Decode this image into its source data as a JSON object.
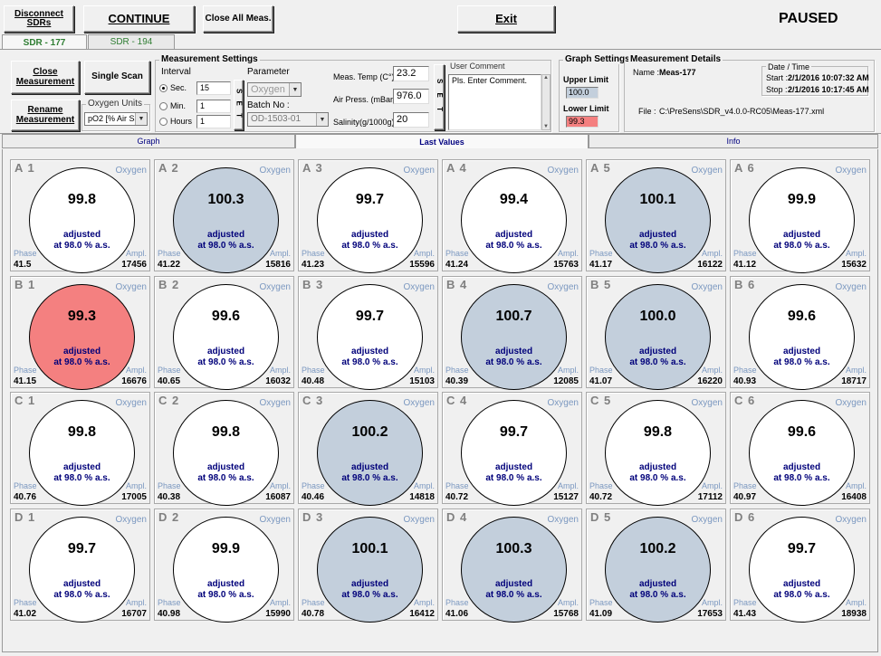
{
  "toolbar": {
    "disconnect_label": "Disconnect SDRs",
    "continue_label": "CONTINUE",
    "close_all_label": "Close All Meas.",
    "exit_label": "Exit",
    "status": "PAUSED"
  },
  "sdr_tabs": [
    {
      "label": "SDR - 177",
      "active": true
    },
    {
      "label": "SDR - 194",
      "active": false
    }
  ],
  "buttons": {
    "close_measurement": "Close Measurement",
    "single_scan": "Single Scan",
    "rename_measurement": "Rename Measurement"
  },
  "oxygen_units": {
    "legend": "Oxygen Units",
    "value": "pO2 [% Air Sat.]"
  },
  "measurement_settings": {
    "legend": "Measurement Settings",
    "interval_label": "Interval",
    "rows": [
      {
        "label": "Sec.",
        "value": "15",
        "selected": true
      },
      {
        "label": "Min.",
        "value": "1",
        "selected": false
      },
      {
        "label": "Hours",
        "value": "1",
        "selected": false
      }
    ],
    "set_label": "S E T",
    "parameter_label": "Parameter",
    "parameter_value": "Oxygen",
    "batch_label": "Batch No :",
    "batch_value": "OD-1503-01",
    "meas_temp_label": "Meas. Temp (C°):",
    "meas_temp_value": "23.2",
    "air_press_label": "Air Press. (mBar):",
    "air_press_value": "976.0",
    "salinity_label": "Salinity(g/1000g):",
    "salinity_value": "20",
    "set2_label": "S E T"
  },
  "user_comment": {
    "legend": "User Comment",
    "value": "Pls. Enter Comment."
  },
  "graph_settings": {
    "legend": "Graph Settings",
    "upper_label": "Upper Limit",
    "upper_value": "100.0",
    "lower_label": "Lower Limit",
    "lower_value": "99.3"
  },
  "details": {
    "legend": "Measurement Details",
    "name_label": "Name :",
    "name_value": "Meas-177",
    "date_legend": "Date / Time",
    "start_label": "Start :",
    "start_value": "2/1/2016 10:07:32 AM",
    "stop_label": "Stop :",
    "stop_value": "2/1/2016 10:17:45 AM",
    "file_label": "File :",
    "file_value": "C:\\PreSens\\SDR_v4.0.0-RC05\\Meas-177.xml"
  },
  "view_tabs": [
    {
      "label": "Graph",
      "active": false
    },
    {
      "label": "Last Values",
      "active": true
    },
    {
      "label": "Info",
      "active": false
    }
  ],
  "wells": [
    {
      "pos": "A 1",
      "value": "99.8",
      "phase": "41.5",
      "ampl": "17456",
      "state": "normal"
    },
    {
      "pos": "A 2",
      "value": "100.3",
      "phase": "41.22",
      "ampl": "15816",
      "state": "high"
    },
    {
      "pos": "A 3",
      "value": "99.7",
      "phase": "41.23",
      "ampl": "15596",
      "state": "normal"
    },
    {
      "pos": "A 4",
      "value": "99.4",
      "phase": "41.24",
      "ampl": "15763",
      "state": "normal"
    },
    {
      "pos": "A 5",
      "value": "100.1",
      "phase": "41.17",
      "ampl": "16122",
      "state": "high"
    },
    {
      "pos": "A 6",
      "value": "99.9",
      "phase": "41.12",
      "ampl": "15632",
      "state": "normal"
    },
    {
      "pos": "B 1",
      "value": "99.3",
      "phase": "41.15",
      "ampl": "16676",
      "state": "low"
    },
    {
      "pos": "B 2",
      "value": "99.6",
      "phase": "40.65",
      "ampl": "16032",
      "state": "normal"
    },
    {
      "pos": "B 3",
      "value": "99.7",
      "phase": "40.48",
      "ampl": "15103",
      "state": "normal"
    },
    {
      "pos": "B 4",
      "value": "100.7",
      "phase": "40.39",
      "ampl": "12085",
      "state": "high"
    },
    {
      "pos": "B 5",
      "value": "100.0",
      "phase": "41.07",
      "ampl": "16220",
      "state": "high"
    },
    {
      "pos": "B 6",
      "value": "99.6",
      "phase": "40.93",
      "ampl": "18717",
      "state": "normal"
    },
    {
      "pos": "C 1",
      "value": "99.8",
      "phase": "40.76",
      "ampl": "17005",
      "state": "normal"
    },
    {
      "pos": "C 2",
      "value": "99.8",
      "phase": "40.38",
      "ampl": "16087",
      "state": "normal"
    },
    {
      "pos": "C 3",
      "value": "100.2",
      "phase": "40.46",
      "ampl": "14818",
      "state": "high"
    },
    {
      "pos": "C 4",
      "value": "99.7",
      "phase": "40.72",
      "ampl": "15127",
      "state": "normal"
    },
    {
      "pos": "C 5",
      "value": "99.8",
      "phase": "40.72",
      "ampl": "17112",
      "state": "normal"
    },
    {
      "pos": "C 6",
      "value": "99.6",
      "phase": "40.97",
      "ampl": "16408",
      "state": "normal"
    },
    {
      "pos": "D 1",
      "value": "99.7",
      "phase": "41.02",
      "ampl": "16707",
      "state": "normal"
    },
    {
      "pos": "D 2",
      "value": "99.9",
      "phase": "40.98",
      "ampl": "15990",
      "state": "normal"
    },
    {
      "pos": "D 3",
      "value": "100.1",
      "phase": "40.78",
      "ampl": "16412",
      "state": "high"
    },
    {
      "pos": "D 4",
      "value": "100.3",
      "phase": "41.06",
      "ampl": "15768",
      "state": "high"
    },
    {
      "pos": "D 5",
      "value": "100.2",
      "phase": "41.09",
      "ampl": "17653",
      "state": "high"
    },
    {
      "pos": "D 6",
      "value": "99.7",
      "phase": "41.43",
      "ampl": "18938",
      "state": "normal"
    }
  ],
  "well_common": {
    "parameter": "Oxygen",
    "adjusted": "adjusted",
    "adjusted_at": "at 98.0 % a.s.",
    "phase_label": "Phase",
    "ampl_label": "Ampl."
  },
  "colors": {
    "high": "#c3cfdc",
    "low": "#f48080",
    "normal": "#ffffff"
  }
}
